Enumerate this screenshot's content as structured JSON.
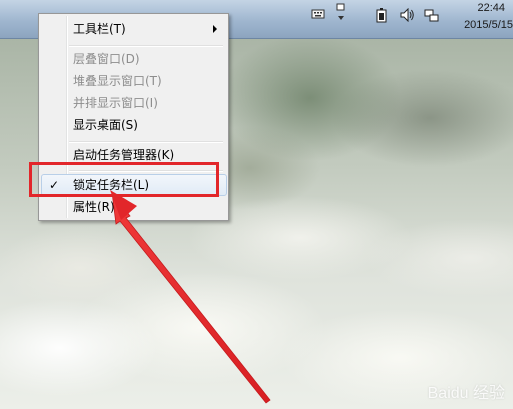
{
  "taskbar": {
    "time": "22:44",
    "date": "2015/5/15",
    "tray_icons": [
      "keyboard-icon",
      "action-center-icon",
      "battery-icon",
      "volume-icon",
      "network-icon"
    ]
  },
  "context_menu": {
    "toolbars": "工具栏(T)",
    "cascade": "层叠窗口(D)",
    "stacked": "堆叠显示窗口(T)",
    "side_by_side": "并排显示窗口(I)",
    "show_desktop": "显示桌面(S)",
    "task_manager": "启动任务管理器(K)",
    "lock_taskbar": "锁定任务栏(L)",
    "properties": "属性(R)",
    "check_mark": "✓"
  },
  "watermark": "Baidu 经验",
  "colors": {
    "highlight": "#e2262a",
    "arrow": "#e2262a",
    "menu_bg": "#f0f0f0"
  }
}
